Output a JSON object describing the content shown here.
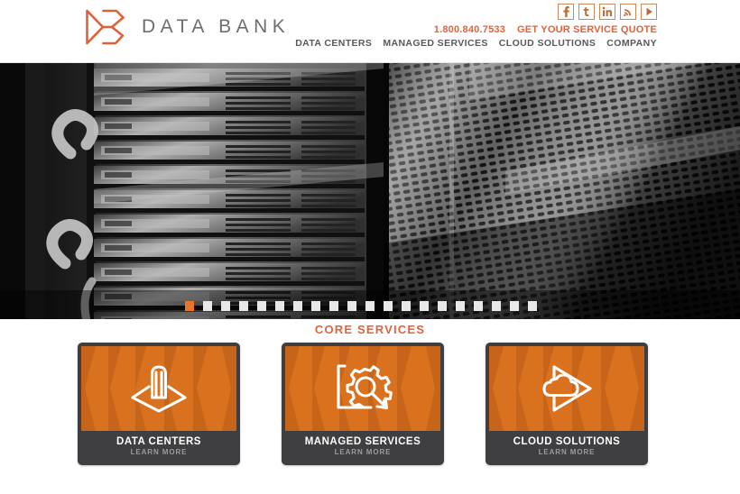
{
  "header": {
    "logo": {
      "icon": "databank-logo-icon",
      "wordmark": "DATA BANK"
    },
    "social": [
      {
        "name": "facebook-icon",
        "label": "f"
      },
      {
        "name": "twitter-icon",
        "label": "t"
      },
      {
        "name": "linkedin-icon",
        "label": "in"
      },
      {
        "name": "rss-icon",
        "label": "rss"
      },
      {
        "name": "youtube-icon",
        "label": "play"
      }
    ],
    "phone": "1.800.840.7533",
    "quote_label": "GET YOUR SERVICE QUOTE",
    "nav": [
      {
        "label": "DATA CENTERS"
      },
      {
        "label": "MANAGED SERVICES"
      },
      {
        "label": "CLOUD SOLUTIONS"
      },
      {
        "label": "COMPANY"
      }
    ]
  },
  "hero": {
    "image_alt": "black and white photograph of data center server racks and perforated cabinet mesh",
    "slides_total": 20,
    "active_slide": 1
  },
  "services": {
    "title": "CORE SERVICES",
    "learn_more_label": "LEARN MORE",
    "cards": [
      {
        "title": "DATA CENTERS",
        "sub": "LEARN MORE",
        "icon": "data-center-building-icon"
      },
      {
        "title": "MANAGED SERVICES",
        "sub": "LEARN MORE",
        "icon": "gear-magnifier-icon"
      },
      {
        "title": "CLOUD SOLUTIONS",
        "sub": "LEARN MORE",
        "icon": "cloud-arrow-icon"
      }
    ]
  },
  "colors": {
    "brand_orange": "#e1633a",
    "card_orange": "#d9711f",
    "logo_orange": "#e0603a",
    "dark_gray": "#3f3f41",
    "nav_gray": "#59595b",
    "accent_dot": "#e8762a"
  }
}
